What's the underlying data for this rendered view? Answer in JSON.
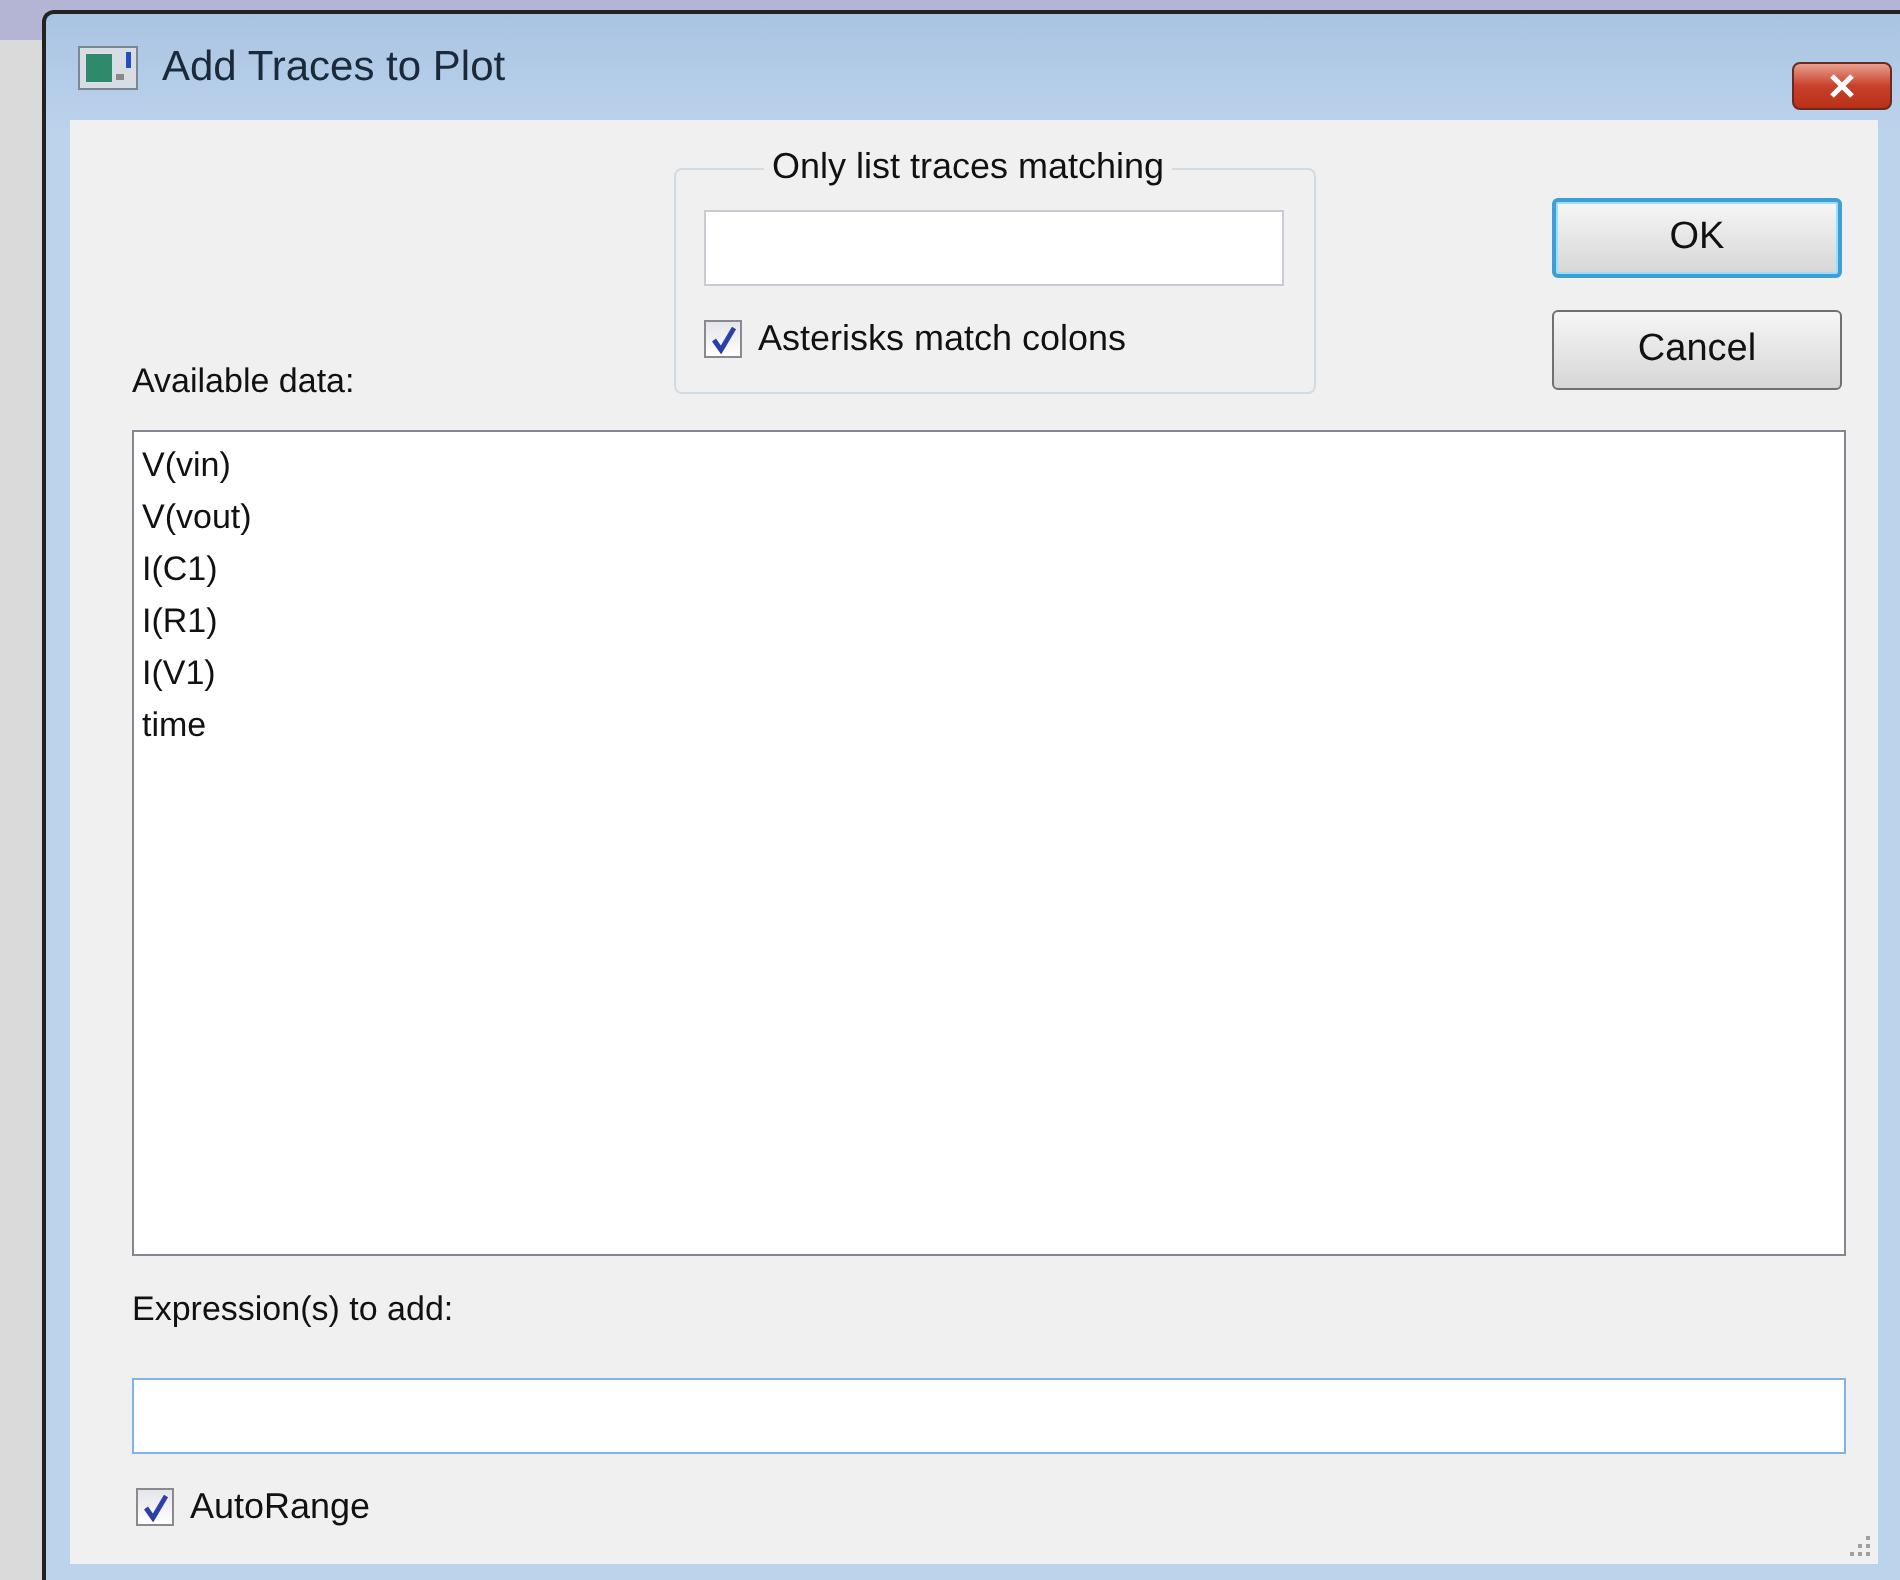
{
  "window": {
    "title": "Add Traces to Plot"
  },
  "filter": {
    "legend": "Only list traces matching",
    "asterisks": {
      "label": "Asterisks match colons",
      "checked": true
    }
  },
  "buttons": [
    {
      "label": "OK",
      "default": true
    },
    {
      "label": "Cancel",
      "default": false
    }
  ],
  "available": {
    "label": "Available data:",
    "items": [
      {
        "label": "V(vin)"
      },
      {
        "label": "V(vout)"
      },
      {
        "label": "I(C1)"
      },
      {
        "label": "I(R1)"
      },
      {
        "label": "I(V1)"
      },
      {
        "label": "time"
      }
    ]
  },
  "expression": {
    "label": "Expression(s) to add:"
  },
  "autorange": {
    "label": "AutoRange",
    "checked": true
  }
}
